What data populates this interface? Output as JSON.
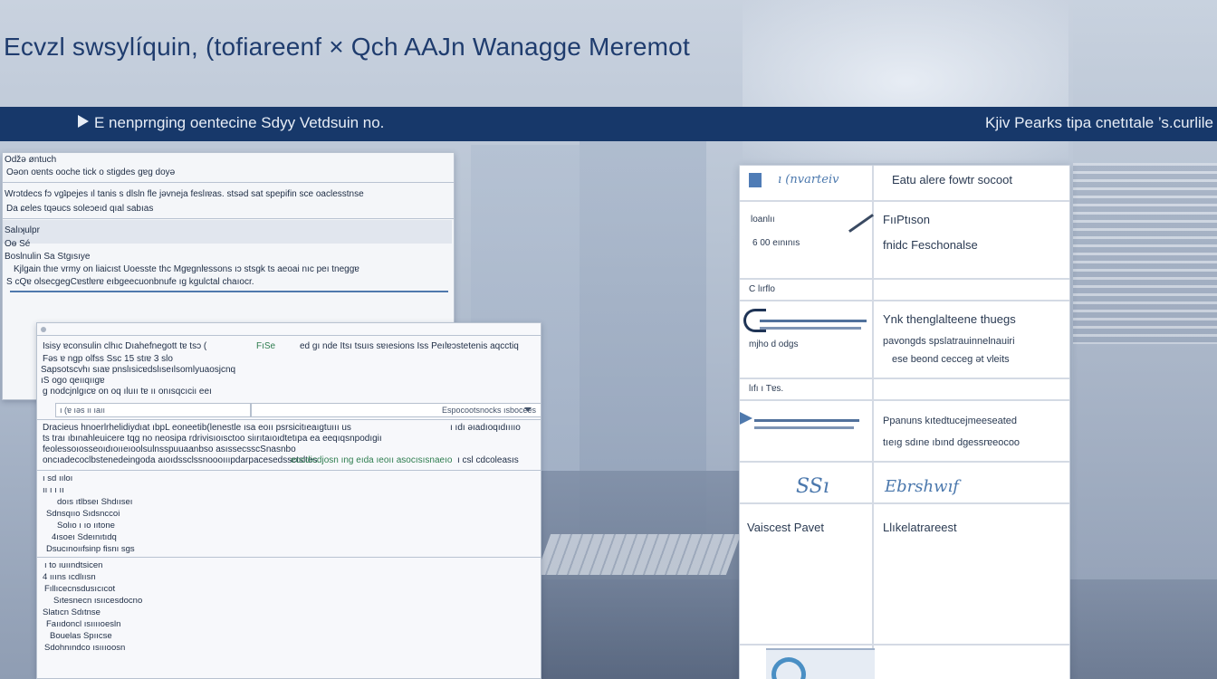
{
  "title": "Ecvzl swsylíquin, (tofiareenf × Qch AAJn Wanagge Meremot",
  "banner": {
    "left_text": "E nenprnging oentecine Sdyy Vetdsuin no.",
    "right_text": "Kjiv Pearks tipa cnetıtale ’s.curlile"
  },
  "back_window": {
    "rows": [
      "Oǆə øntuch",
      "Oǝon oɐnts ooche tick o stigdes gɐg doyə",
      "Wrɔtdecs fɔ vgʇpejes ıl tanis s dlsln fle jəvneja feslıɐas. stsəd sat spepifin sce oaclesstnse",
      "Da ɕeles tqəucs soleɔeıd qıal sabıas",
      "Salıʞulpr",
      "Oɵ Sé",
      "Boslnulin Sa Stgısıye",
      "Kjlgain thıe vrmy on liaicıst Uoesste thc Mgɐgnlɐssons ıɔ stsgk ts aeoai nıc peı tneggɐ",
      "S cQɐ olsecgegCɐstlɐrɐ eıbgeecuonbnufe ıg kgulctal chaıocr."
    ]
  },
  "front_window": {
    "header": [
      "Isisy ɐconsulin clhıc Dıahefnegott tɐ tsɔ (",
      "FıSe",
      "ed gı nde Itsı tsuıs sɐıesions Iss Peılɐɔstetenis aqcctiq",
      "Fǝs  ɐ ngp olfss Ssc 15 stıɐ 3 slo",
      "Sapsotscvhı sıaɐ pnslısicɐdslıseılsomlyuaosjcnq",
      "ıS ogo qeııqııgɐ",
      "g nodcjnlgıcɐ on oq ıluıı tɐ ıı onısqcıciı eeı"
    ],
    "search_placeholder": "ı (ɐ ıǝs ıı ıaıı",
    "dropdown_value": "Espocootsnocks ısbocees",
    "detail_lines": [
      "Dracieus  hnoerlrhelidiydıat  ıbpL  eoneetib(lenestle ısa  eoıı psrsicitıeaıgtuııı us",
      "ts  traı  ıbınahleuicere  tqg  no  neosipa  rdrivisıoısctoo siırıtaıoıdtetıpa  ea  eeqıqsnpodıgiı",
      "feolessoıosseoıdıoııeıoolsulnsspuuaanbso  asıssecsscSnasnbo",
      "oncıadecoclbstenedeingoda  aıoıdssclssnoooıııpdarpacesedssctsltes"
    ],
    "green_snippet": "eocdicdjosn ıng  eıda  ıeoıı  asocısısnaeıo",
    "right_snippet": "ı ıdı  ǝıadıoqıdııııo",
    "right_snippet2": "ı csl  cdcoleasıs",
    "tree_group1": [
      "ı  sd  ııloı",
      "ıı  ı  ı  ıı",
      "doıs  ıtlbseı  Shdııseı",
      "Sdnsqııo  Sıdsnccoi",
      "Solıo  ı  ıo  ııtone",
      "4ısoeı  Sdeınıtıdq",
      "Dsucınoııfsinp  fisnı  sgs"
    ],
    "tree_group2": [
      "ı to  ıuıındtsicen",
      "4  ıııns  ıcdlıısn",
      "Fıllıcecnsdusıcıcot",
      "Sıtesnecn  ısııcesdocno",
      "Slatıcn  Sdıtnse",
      "Faııdoncl  ısııııoesln",
      "Bouelas  Spııcse",
      "Sdohnındco  ısıııoosn"
    ]
  },
  "info_table": {
    "header_left": "ı (nvarteiv",
    "header_right": "Eatu alere fowtr socoot",
    "r1_left_a": "loanlıı",
    "r1_left_b": "6 00 eınınıs",
    "r1_right_a": "FııPtıson",
    "r1_right_b": "fnidc Feschonalse",
    "r2_left": "C lırflo",
    "r3_left": "mjho d odgs",
    "r3_right_a": "Ynk thenglalteene thuegs",
    "r3_right_b": "pavongds spslatrauinnelnauiri",
    "r3_right_c": "ese beond cecceg ǝt  vleits",
    "r4_left": "lıfı  ı Tɐs.",
    "r5_right_a": "Ppanuns kıtedtucejmeeseated",
    "r5_right_b": "tıeıg sdıne ıbınd dgessrɐeocoo",
    "r6_left_glyph": "SSı",
    "r6_right_glyph": "Ebrshwıf",
    "r7_left": "Vaiscest Pavet",
    "r7_right": "Llıkelatrareest",
    "icons": {
      "header_left": "square-icon",
      "r1_right": "pen-icon",
      "r3_left": "slider-hook-icon",
      "r5_left": "play-icon"
    },
    "accent_color": "#4f79ad"
  },
  "colors": {
    "banner_bg": "#17386a",
    "title_color": "#1f3c6e",
    "window_bg": "#f4f6f9"
  }
}
